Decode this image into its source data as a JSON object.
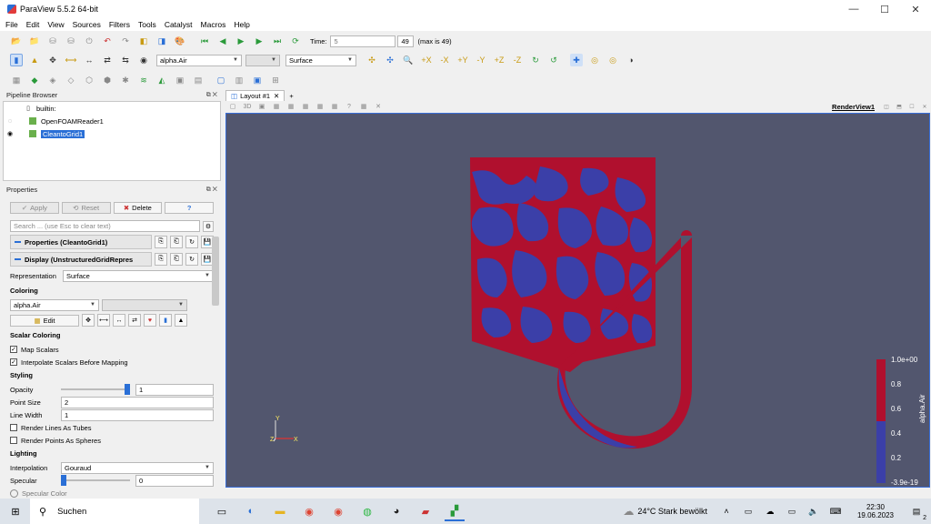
{
  "window": {
    "title": "ParaView 5.5.2 64-bit",
    "min": "—",
    "max": "☐",
    "close": "✕"
  },
  "menu": [
    "File",
    "Edit",
    "View",
    "Sources",
    "Filters",
    "Tools",
    "Catalyst",
    "Macros",
    "Help"
  ],
  "time": {
    "label": "Time:",
    "value": "5",
    "index": "49",
    "max_text": "(max is 49)"
  },
  "toolbar2": {
    "array": "alpha.Air",
    "representation": "Surface"
  },
  "pipeline": {
    "title": "Pipeline Browser",
    "items": [
      {
        "label": "builtin:"
      },
      {
        "label": "OpenFOAMReader1"
      },
      {
        "label": "CleantoGrid1"
      }
    ]
  },
  "properties": {
    "title": "Properties",
    "apply": "Apply",
    "reset": "Reset",
    "delete": "Delete",
    "help": "?",
    "search_placeholder": "Search ... (use Esc to clear text)",
    "sec_props": "Properties (CleantoGrid1)",
    "sec_display": "Display (UnstructuredGridRepres",
    "representation_label": "Representation",
    "representation_value": "Surface",
    "coloring": "Coloring",
    "coloring_array": "alpha.Air",
    "edit": "Edit",
    "scalar_coloring": "Scalar Coloring",
    "map_scalars": "Map Scalars",
    "interp_scalars": "Interpolate Scalars Before Mapping",
    "styling": "Styling",
    "opacity_label": "Opacity",
    "opacity": "1",
    "point_size_label": "Point Size",
    "point_size": "2",
    "line_width_label": "Line Width",
    "line_width": "1",
    "tubes": "Render Lines As Tubes",
    "spheres": "Render Points As Spheres",
    "lighting": "Lighting",
    "interp_label": "Interpolation",
    "interp_value": "Gouraud",
    "specular_label": "Specular",
    "specular": "0",
    "specular_color": "Specular Color"
  },
  "layout": {
    "tab": "Layout #1",
    "add": "+",
    "view_label": "RenderView1"
  },
  "colorbar": {
    "title": "alpha.Air",
    "ticks": [
      "1.0e+00",
      "0.8",
      "0.6",
      "0.4",
      "0.2",
      "-3.9e-19"
    ],
    "high_color": "#b0102e",
    "low_color": "#3b3fa8"
  },
  "axes": {
    "y": "Y",
    "z": "Z",
    "x": "X"
  },
  "taskbar": {
    "search": "Suchen",
    "weather": "24°C  Stark bewölkt",
    "time": "22:30",
    "date": "19.06.2023",
    "notif": "2"
  }
}
